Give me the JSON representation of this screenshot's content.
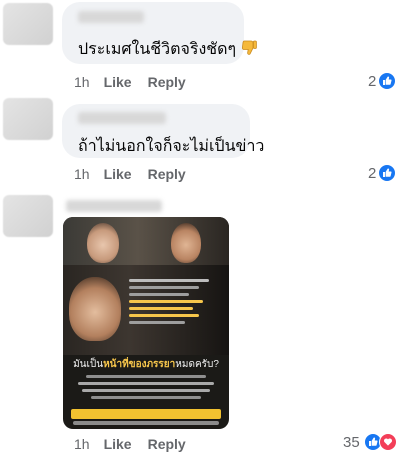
{
  "comments": [
    {
      "text": "ประเมศในชีวิตจริงชัดๆ",
      "emoji_icon": "thumbs-down-emoji",
      "time": "1h",
      "like": "Like",
      "reply": "Reply",
      "reaction_count": "2",
      "reaction_icon": "like-icon"
    },
    {
      "text": "ถ้าไม่นอกใจก็จะไม่เป็นข่าว",
      "time": "1h",
      "like": "Like",
      "reply": "Reply",
      "reaction_count": "2",
      "reaction_icon": "like-icon"
    },
    {
      "image": {
        "caption_main_prefix": "มันเป็น",
        "caption_main_highlight": "หน้าที่ของภรรยา",
        "caption_main_suffix": "หมดครับ?"
      },
      "time": "1h",
      "like": "Like",
      "reply": "Reply",
      "reaction_count": "35",
      "reaction_icons": [
        "like-icon",
        "heart-icon"
      ]
    }
  ],
  "colors": {
    "bubble": "#f0f2f5",
    "meta": "#65676b",
    "like_blue": "#1877f2",
    "heart_red": "#f33e58",
    "highlight_yellow": "#f7c64b"
  }
}
